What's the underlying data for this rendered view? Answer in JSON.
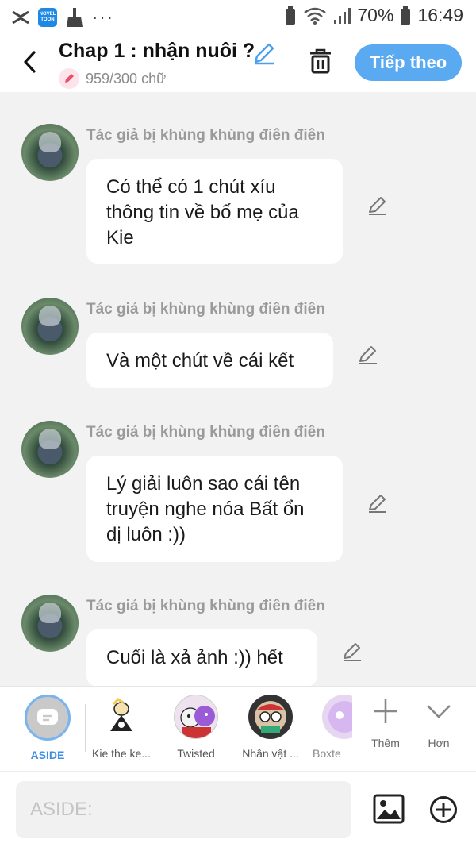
{
  "status_bar": {
    "battery": "70%",
    "time": "16:49",
    "app_badge": "NOVEL TOON"
  },
  "header": {
    "title": "Chap 1 : nhận nuôi ?",
    "word_count": "959/300 chữ",
    "next_button": "Tiếp theo"
  },
  "messages": [
    {
      "author": "Tác giả bị khùng khùng điên điên",
      "text": "Có thể có 1 chút xíu thông tin về bố mẹ của Kie"
    },
    {
      "author": "Tác giả bị khùng khùng điên điên",
      "text": "Và một chút về cái kết"
    },
    {
      "author": "Tác giả bị khùng khùng điên điên",
      "text": "Lý giải luôn sao cái tên truyện nghe nóa Bất ổn dị luôn :))"
    },
    {
      "author": "Tác giả bị khùng khùng điên điên",
      "text": "Cuối là xả ảnh :)) hết"
    }
  ],
  "characters": {
    "aside": "ASIDE",
    "items": [
      "Kie the ke...",
      "Twisted",
      "Nhân vật ...",
      "Boxte"
    ],
    "more_label": "Thêm",
    "extra_label": "Hơn"
  },
  "composer": {
    "placeholder": "ASIDE:"
  },
  "colors": {
    "accent": "#5aaaf2",
    "aside_label": "#3e8ee8",
    "background": "#f2f2f2"
  }
}
